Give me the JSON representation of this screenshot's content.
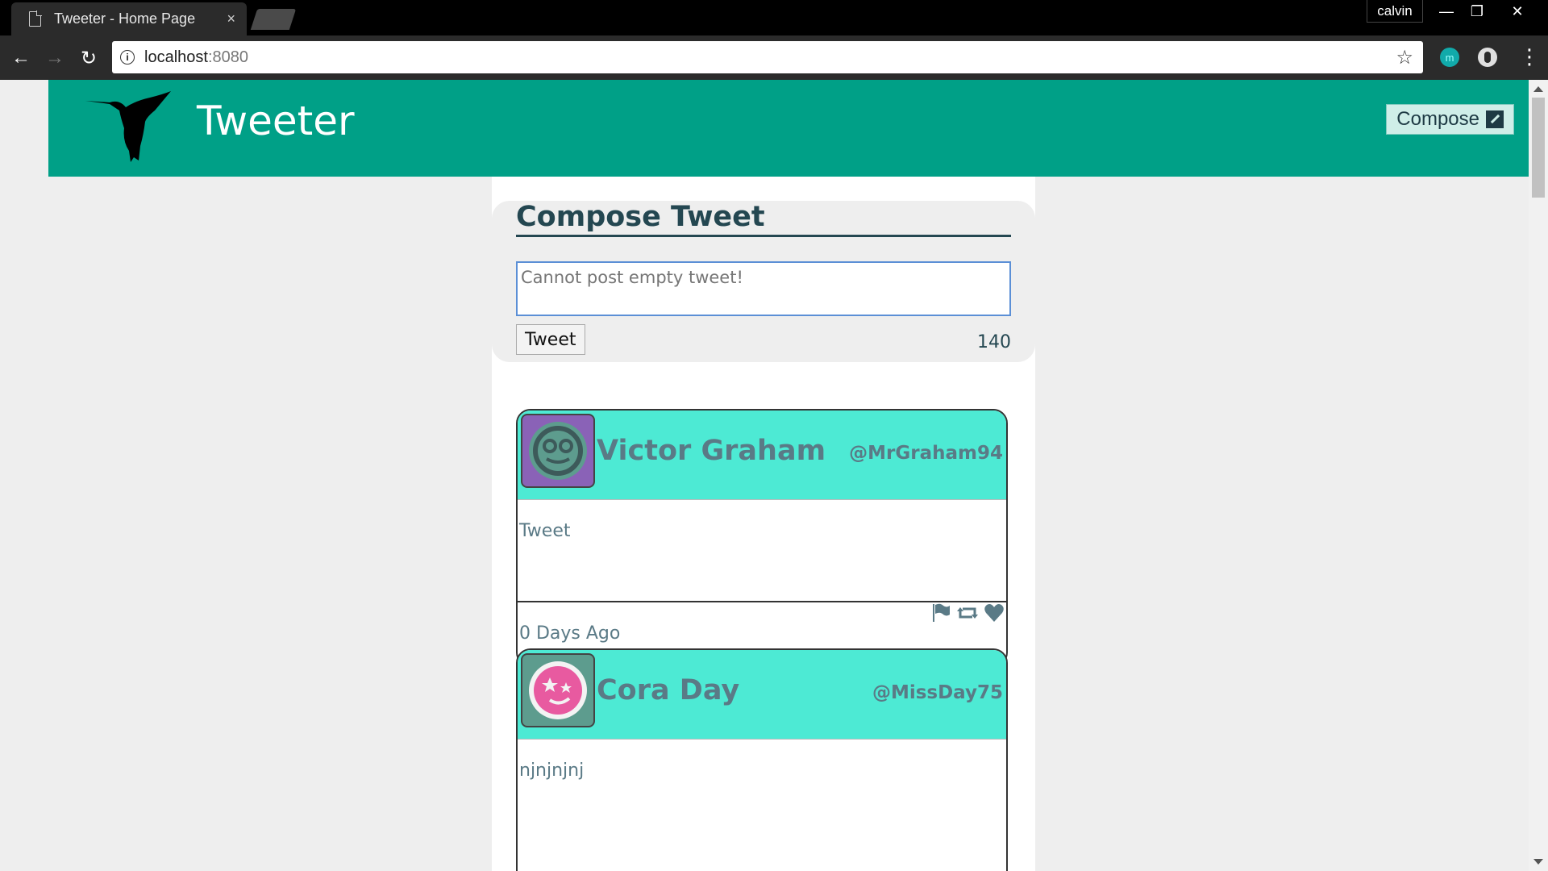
{
  "browser": {
    "tab_title": "Tweeter - Home Page",
    "tab_close": "×",
    "profile_name": "calvin",
    "url_host": "localhost",
    "url_port": ":8080",
    "info_glyph": "i",
    "star_glyph": "☆",
    "ext_m_label": "m",
    "menu_glyph": "⋮",
    "back_glyph": "←",
    "forward_glyph": "→",
    "reload_glyph": "↻",
    "minimize_glyph": "—",
    "restore_glyph": "❐",
    "close_glyph": "✕"
  },
  "nav": {
    "brand": "Tweeter",
    "compose_label": "Compose",
    "accent_color": "#00a087"
  },
  "compose": {
    "title": "Compose Tweet",
    "placeholder": "Cannot post empty tweet!",
    "button_label": "Tweet",
    "counter": "140"
  },
  "tweets": [
    {
      "name": "Victor Graham",
      "handle": "@MrGraham94",
      "text": "Tweet",
      "time": "0 Days Ago",
      "avatar_icon": "glasses-face-avatar",
      "avatar_bg": "#8a62b7"
    },
    {
      "name": "Cora Day",
      "handle": "@MissDay75",
      "text": "njnjnjnj",
      "time": "",
      "avatar_icon": "stars-face-avatar",
      "avatar_bg": "#5d9c8e"
    }
  ]
}
